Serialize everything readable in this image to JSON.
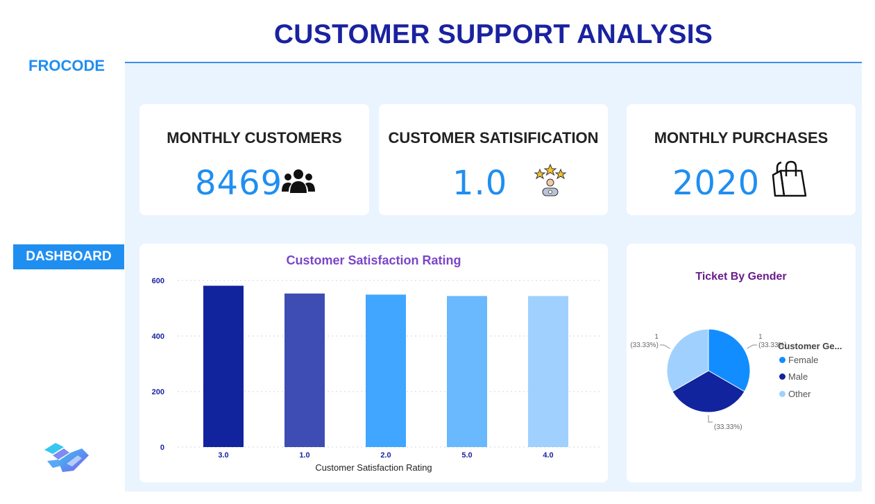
{
  "header": {
    "title": "CUSTOMER SUPPORT ANALYSIS",
    "brand": "FROCODE"
  },
  "nav": {
    "dashboard_label": "DASHBOARD"
  },
  "kpis": [
    {
      "label": "MONTHLY CUSTOMERS",
      "value": "8469",
      "icon": "users-icon"
    },
    {
      "label": "CUSTOMER SATISIFICATION",
      "value": "1.0",
      "icon": "rating-stars-icon"
    },
    {
      "label": "MONTHLY PURCHASES",
      "value": "2020",
      "icon": "shopping-bag-icon"
    }
  ],
  "colors": {
    "accent": "#1f8ef1",
    "title": "#1a22a0",
    "panel_bg": "#eaf4fe"
  },
  "chart_data": [
    {
      "type": "bar",
      "title": "Customer Satisfaction Rating",
      "xlabel": "Customer Satisfaction Rating",
      "ylabel": "",
      "categories": [
        "3.0",
        "1.0",
        "2.0",
        "5.0",
        "4.0"
      ],
      "values": [
        581,
        553,
        549,
        544,
        544
      ],
      "colors": [
        "#12239e",
        "#3d4db3",
        "#40a6ff",
        "#6ab8fd",
        "#a0d1fe"
      ],
      "ylim": [
        0,
        600
      ],
      "yticks": [
        "0",
        "200",
        "400",
        "600"
      ],
      "grid": true
    },
    {
      "type": "pie",
      "title": "Ticket By Gender",
      "legend_title": "Customer Ge...",
      "legend_position": "right",
      "slices": [
        {
          "label": "Female",
          "value": 1,
          "pct": "(33.33%)",
          "color": "#118dff"
        },
        {
          "label": "Male",
          "value": 1,
          "pct": "(33.33%)",
          "color": "#12239e"
        },
        {
          "label": "Other",
          "value": 1,
          "pct": "(33.33%)",
          "color": "#a0d1fe"
        }
      ]
    }
  ]
}
